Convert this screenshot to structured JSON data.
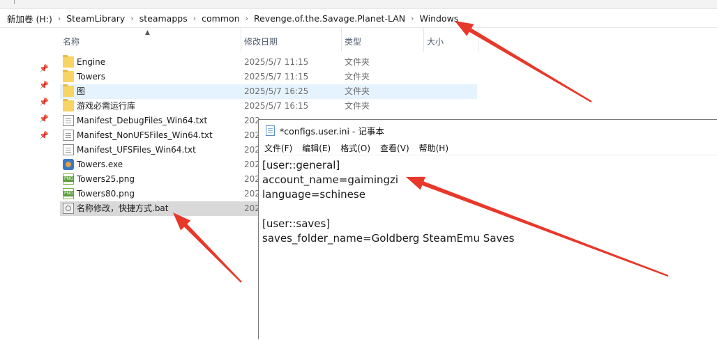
{
  "breadcrumb": [
    "新加卷 (H:)",
    "SteamLibrary",
    "steamapps",
    "common",
    "Revenge.of.the.Savage.Planet-LAN",
    "Windows"
  ],
  "columns": {
    "name": "名称",
    "date": "修改日期",
    "type": "类型",
    "size": "大小"
  },
  "files": [
    {
      "name": "Engine",
      "date": "2025/5/7 11:15",
      "type": "文件夹",
      "icon": "folder-icon",
      "state": ""
    },
    {
      "name": "Towers",
      "date": "2025/5/7 11:15",
      "type": "文件夹",
      "icon": "folder-icon",
      "state": ""
    },
    {
      "name": "图",
      "date": "2025/5/7 16:25",
      "type": "文件夹",
      "icon": "folder-icon",
      "state": "hl"
    },
    {
      "name": "游戏必需运行库",
      "date": "2025/5/7 16:15",
      "type": "文件夹",
      "icon": "folder-icon",
      "state": ""
    },
    {
      "name": "Manifest_DebugFiles_Win64.txt",
      "date": "202",
      "type": "",
      "icon": "txt-icon",
      "state": ""
    },
    {
      "name": "Manifest_NonUFSFiles_Win64.txt",
      "date": "202",
      "type": "",
      "icon": "txt-icon",
      "state": ""
    },
    {
      "name": "Manifest_UFSFiles_Win64.txt",
      "date": "202",
      "type": "",
      "icon": "txt-icon",
      "state": ""
    },
    {
      "name": "Towers.exe",
      "date": "202",
      "type": "",
      "icon": "exe-icon",
      "state": ""
    },
    {
      "name": "Towers25.png",
      "date": "202",
      "type": "",
      "icon": "png-icon",
      "state": ""
    },
    {
      "name": "Towers80.png",
      "date": "202",
      "type": "",
      "icon": "png-icon",
      "state": ""
    },
    {
      "name": "名称修改，快捷方式.bat",
      "date": "202",
      "type": "",
      "icon": "bat-icon",
      "state": "sel"
    }
  ],
  "notepad": {
    "title": "*configs.user.ini - 记事本",
    "menu": [
      "文件(F)",
      "编辑(E)",
      "格式(O)",
      "查看(V)",
      "帮助(H)"
    ],
    "lines": [
      "[user::general]",
      "account_name=gaimingzi",
      "language=schinese",
      "",
      "[user::saves]",
      "saves_folder_name=Goldberg SteamEmu Saves"
    ]
  },
  "colors": {
    "arrow": "#e8382a",
    "hover_row": "#e5f3ff",
    "selected_row": "#d9d9d9"
  }
}
